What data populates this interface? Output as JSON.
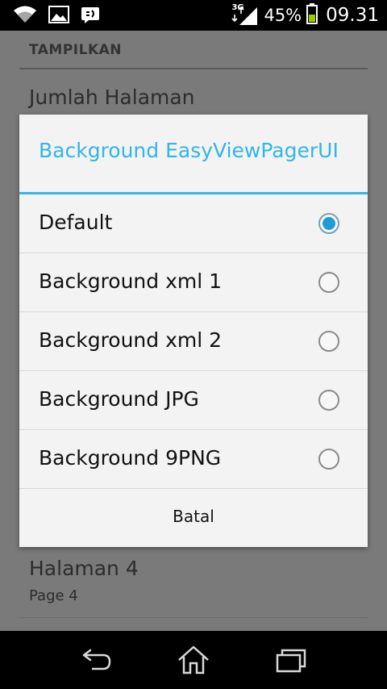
{
  "status_bar": {
    "network": "3G",
    "battery": "45%",
    "time": "09.31"
  },
  "background": {
    "section_header": "TAMPILKAN",
    "item_top_title": "Jumlah Halaman",
    "item_bottom_title": "Halaman 4",
    "item_bottom_subtitle": "Page 4"
  },
  "dialog": {
    "title": "Background EasyViewPagerUI",
    "options": [
      {
        "label": "Default",
        "selected": true
      },
      {
        "label": "Background xml 1",
        "selected": false
      },
      {
        "label": "Background xml 2",
        "selected": false
      },
      {
        "label": "Background JPG",
        "selected": false
      },
      {
        "label": "Background 9PNG",
        "selected": false
      }
    ],
    "cancel_label": "Batal",
    "accent_color": "#33b5e5"
  },
  "navigation": {
    "back": "back-icon",
    "home": "home-icon",
    "recents": "recent-apps-icon"
  }
}
